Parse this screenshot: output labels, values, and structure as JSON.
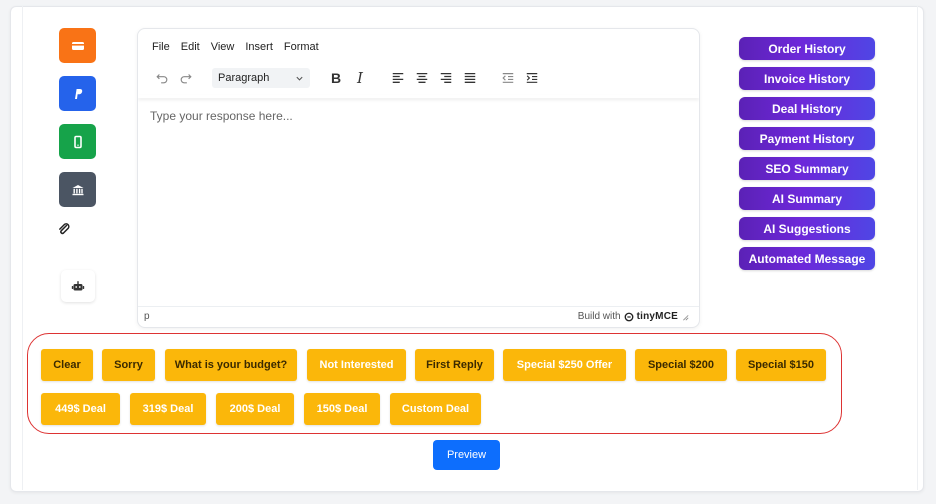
{
  "sidebar": {
    "icons": [
      {
        "name": "credit-card-icon",
        "color": "#f97316"
      },
      {
        "name": "paypal-icon",
        "color": "#2563eb"
      },
      {
        "name": "mobile-phone-icon",
        "color": "#16a34a"
      },
      {
        "name": "bank-icon",
        "color": "#4b5563"
      },
      {
        "name": "paperclip-icon",
        "color": "#222222"
      },
      {
        "name": "robot-icon",
        "color": "#222222"
      }
    ]
  },
  "editor": {
    "menu": [
      "File",
      "Edit",
      "View",
      "Insert",
      "Format"
    ],
    "format_select": "Paragraph",
    "bold_label": "B",
    "italic_label": "I",
    "placeholder": "Type your response here...",
    "status_path": "p",
    "branding_prefix": "Build with",
    "branding_name": "tinyMCE"
  },
  "history_buttons": [
    "Order History",
    "Invoice History",
    "Deal History",
    "Payment History",
    "SEO Summary",
    "AI Summary",
    "AI Suggestions",
    "Automated Message"
  ],
  "quick_replies": {
    "row1": [
      "Clear",
      "Sorry",
      "What is your budget?",
      "Not Interested",
      "First Reply",
      "Special $250 Offer",
      "Special $200",
      "Special $150"
    ],
    "row2": [
      "449$ Deal",
      "319$ Deal",
      "200$ Deal",
      "150$ Deal",
      "Custom Deal"
    ]
  },
  "preview_label": "Preview",
  "colors": {
    "accent_purple": "#6d28d9",
    "quick_reply_yellow": "#fbb70a",
    "preview_blue": "#0d6efd",
    "highlight_border": "#dd3333"
  }
}
